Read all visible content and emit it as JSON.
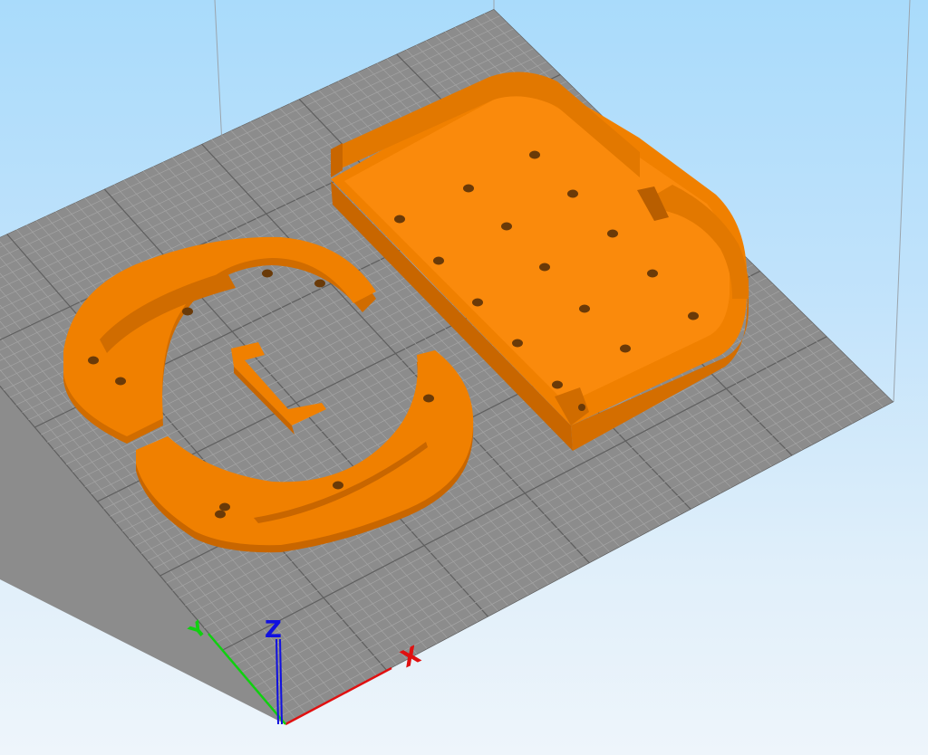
{
  "viewport": {
    "background_top": "#a9dbfb",
    "background_bottom": "#eef5fb",
    "bed_color": "#8c8c8c",
    "grid_minor_color": "#a4a4a4",
    "grid_major_color": "#5f5f5f",
    "model_color": "#f08000",
    "model_shade": "#c86600",
    "model_top": "#fa8a0c",
    "hole_color": "#6a3a08"
  },
  "axes": {
    "x": {
      "label": "X",
      "color": "#e01010"
    },
    "y": {
      "label": "Y",
      "color": "#10d010"
    },
    "z": {
      "label": "Z",
      "color": "#1010e0"
    }
  },
  "models": {
    "tray": "model-tray",
    "ring_left": "model-ring-left",
    "ring_right": "model-ring-right",
    "clip": "model-clip"
  }
}
